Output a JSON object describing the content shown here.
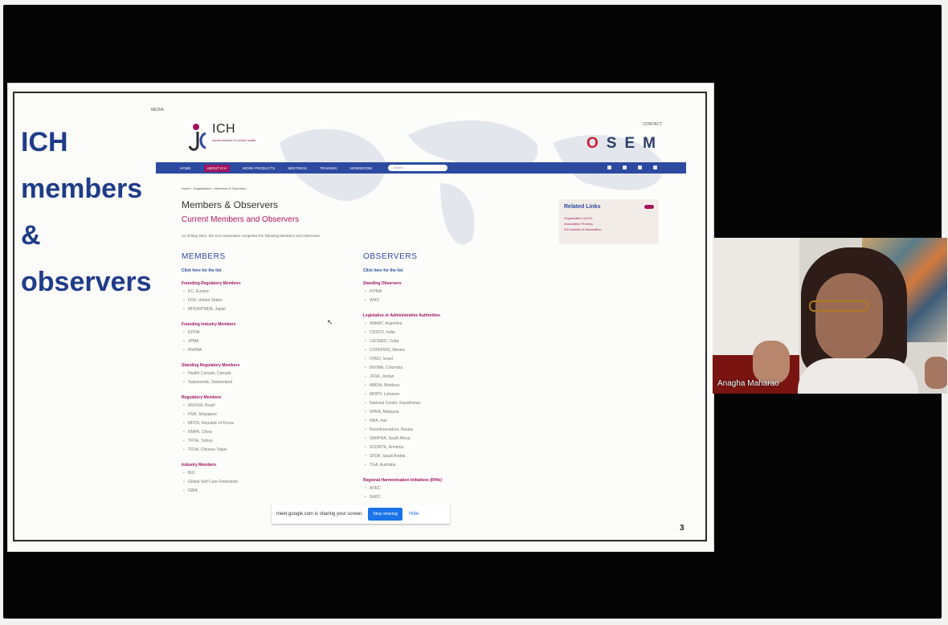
{
  "slide": {
    "title_lines": [
      "ICH",
      "members",
      "&",
      "observers"
    ],
    "page_number": "3"
  },
  "site": {
    "top_link_left": "MEDIA",
    "top_link_right": "CONTACT",
    "logo_name": "ICH",
    "logo_tagline": "harmonisation for better health",
    "osem_text": "OSEM",
    "nav": [
      "HOME",
      "ABOUT ICH",
      "WORK PRODUCTS",
      "MEETINGS",
      "TRAINING",
      "NEWSROOM"
    ],
    "nav_search_placeholder": "Search",
    "breadcrumb": "Home › Organisation › Members & Observers",
    "heading": "Members & Observers",
    "subheading": "Current Members and Observers",
    "intro": "As of May 2021, the ICH Association comprises the following Members and Observers:",
    "members": {
      "header": "MEMBERS",
      "link": "Click here for the list",
      "groups": [
        {
          "title": "Founding Regulatory Members",
          "items": [
            "EC, Europe",
            "FDA, United States",
            "MHLW/PMDA, Japan"
          ]
        },
        {
          "title": "Founding Industry Members",
          "items": [
            "EFPIA",
            "JPMA",
            "PhRMA"
          ]
        },
        {
          "title": "Standing Regulatory Members",
          "items": [
            "Health Canada, Canada",
            "Swissmedic, Switzerland"
          ]
        },
        {
          "title": "Regulatory Members",
          "items": [
            "ANVISA, Brazil",
            "HSA, Singapore",
            "MFDS, Republic of Korea",
            "NMPA, China",
            "TFDA, Turkey",
            "TFDA, Chinese Taipei"
          ]
        },
        {
          "title": "Industry Members",
          "items": [
            "BIO",
            "Global Self-Care Federation",
            "IGBA"
          ]
        }
      ]
    },
    "observers": {
      "header": "OBSERVERS",
      "link": "Click here for the list",
      "groups": [
        {
          "title": "Standing Observers",
          "items": [
            "IFPMA",
            "WHO"
          ]
        },
        {
          "title": "Legislative or Administrative Authorities",
          "items": [
            "ANMAT, Argentina",
            "CDSCO, India",
            "CECMED, Cuba",
            "COFEPRIS, Mexico",
            "CPED, Israel",
            "INVIMA, Colombia",
            "JFDA, Jordan",
            "MMDA, Moldova",
            "MOPH, Lebanon",
            "National Center, Kazakhstan",
            "NPRA, Malaysia",
            "NRA, Iran",
            "Roszdravnadzor, Russia",
            "SAHPRA, South Africa",
            "SCDMTE, Armenia",
            "SFDA, Saudi Arabia",
            "TGA, Australia"
          ]
        },
        {
          "title": "Regional Harmonisation Initiatives (RHIs)",
          "items": [
            "APEC",
            "",
            "",
            "SADC"
          ]
        }
      ]
    },
    "related": {
      "title": "Related Links",
      "links": [
        "Organisation of ICH",
        "Association Process",
        "ICH Articles of Association"
      ]
    }
  },
  "share_bar": {
    "text": "meet.google.com is sharing your screen.",
    "stop_label": "Stop sharing",
    "hide_label": "Hide"
  },
  "video": {
    "participant_name": "Anagha Maharao"
  }
}
